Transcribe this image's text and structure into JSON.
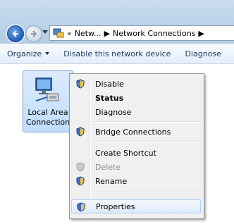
{
  "address": {
    "crumb1": "Netw...",
    "crumb2": "Network Connections"
  },
  "toolbar": {
    "organize": "Organize",
    "disable": "Disable this network device",
    "diagnose": "Diagnose"
  },
  "item": {
    "label_line1": "Local Area",
    "label_line2": "Connection"
  },
  "menu": {
    "disable": "Disable",
    "status": "Status",
    "diagnose": "Diagnose",
    "bridge": "Bridge Connections",
    "shortcut": "Create Shortcut",
    "delete": "Delete",
    "rename": "Rename",
    "properties": "Properties"
  },
  "colors": {
    "shield_blue": "#3b6fd4",
    "shield_yellow": "#f4c634"
  }
}
